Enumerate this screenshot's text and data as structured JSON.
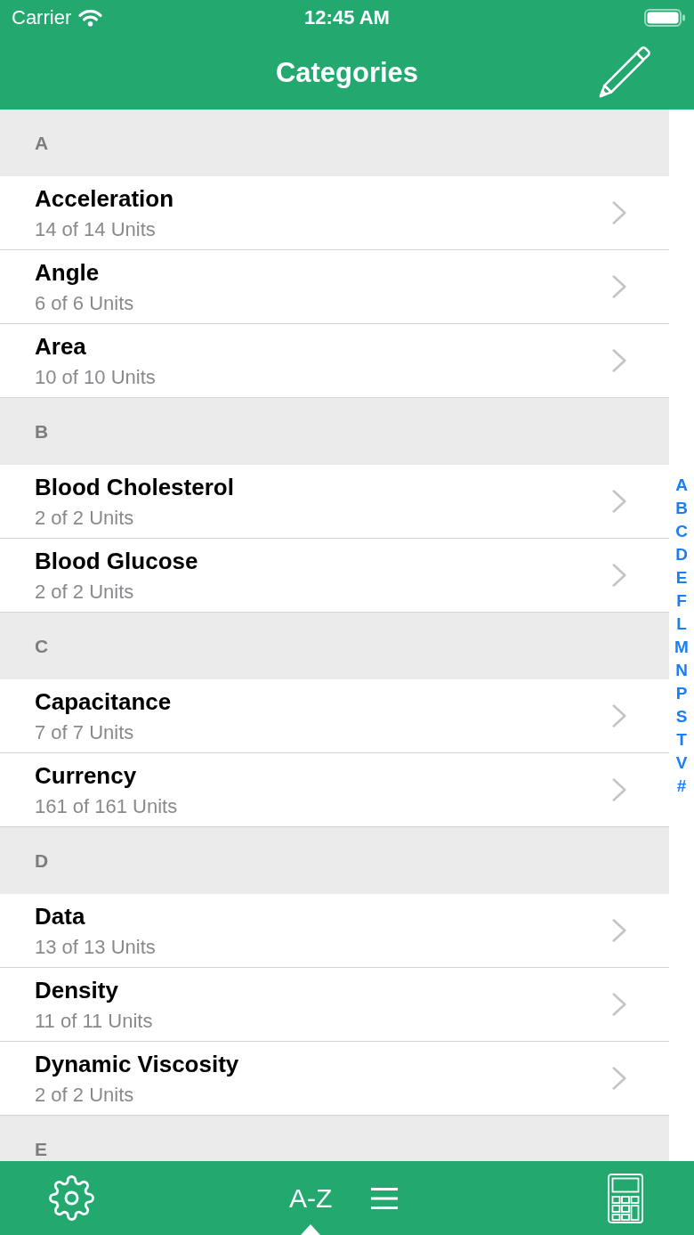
{
  "status_bar": {
    "carrier": "Carrier",
    "time": "12:45 AM"
  },
  "nav_bar": {
    "title": "Categories"
  },
  "sections": [
    {
      "letter": "A",
      "rows": [
        {
          "title": "Acceleration",
          "subtitle": "14 of 14 Units"
        },
        {
          "title": "Angle",
          "subtitle": "6 of 6 Units"
        },
        {
          "title": "Area",
          "subtitle": "10 of 10 Units"
        }
      ]
    },
    {
      "letter": "B",
      "rows": [
        {
          "title": "Blood Cholesterol",
          "subtitle": "2 of 2 Units"
        },
        {
          "title": "Blood Glucose",
          "subtitle": "2 of 2 Units"
        }
      ]
    },
    {
      "letter": "C",
      "rows": [
        {
          "title": "Capacitance",
          "subtitle": "7 of 7 Units"
        },
        {
          "title": "Currency",
          "subtitle": "161 of 161 Units"
        }
      ]
    },
    {
      "letter": "D",
      "rows": [
        {
          "title": "Data",
          "subtitle": "13 of 13 Units"
        },
        {
          "title": "Density",
          "subtitle": "11 of 11 Units"
        },
        {
          "title": "Dynamic Viscosity",
          "subtitle": "2 of 2 Units"
        }
      ]
    },
    {
      "letter": "E"
    }
  ],
  "index": [
    "A",
    "B",
    "C",
    "D",
    "E",
    "F",
    "L",
    "M",
    "N",
    "P",
    "S",
    "T",
    "V",
    "#"
  ],
  "tab_bar": {
    "items": [
      {
        "kind": "gear",
        "selected": false
      },
      {
        "kind": "text",
        "label": "A-Z",
        "selected": true
      },
      {
        "kind": "list",
        "selected": false
      },
      {
        "kind": "calculator",
        "selected": false
      }
    ]
  }
}
